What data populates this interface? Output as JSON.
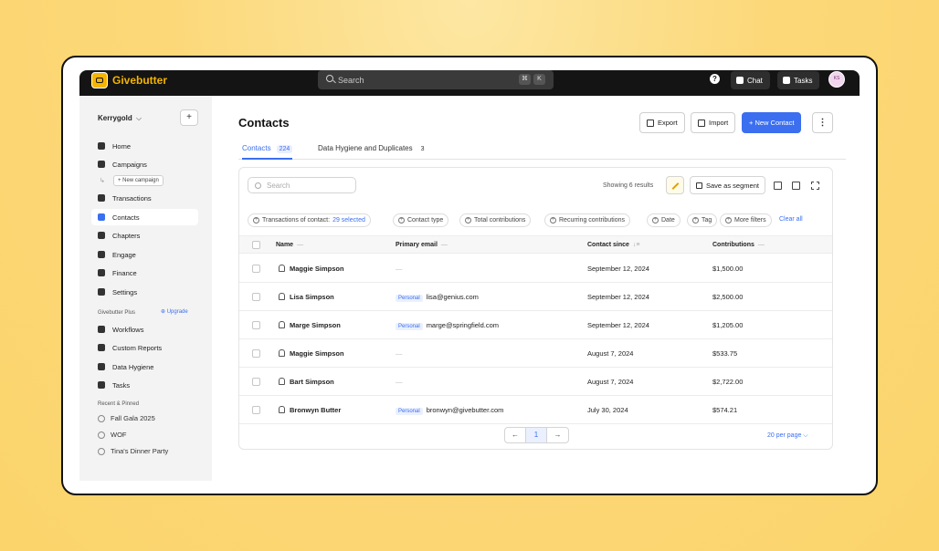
{
  "app": {
    "logo": "Givebutter"
  },
  "topbar": {
    "search_placeholder": "Search",
    "kbd_1": "⌘",
    "kbd_2": "K",
    "help": "?",
    "chat": "Chat",
    "tasks": "Tasks",
    "avatar_initials": "KS"
  },
  "sidebar": {
    "org": "Kerrygold",
    "org_caret": "⌵",
    "org_add": "+",
    "items": [
      {
        "label": "Home",
        "icon": "home-icon"
      },
      {
        "label": "Campaigns",
        "icon": "megaphone-icon"
      },
      {
        "label": "Transactions",
        "icon": "receipt-icon"
      },
      {
        "label": "Contacts",
        "icon": "users-icon"
      },
      {
        "label": "Chapters",
        "icon": "network-icon"
      },
      {
        "label": "Engage",
        "icon": "mail-icon"
      },
      {
        "label": "Finance",
        "icon": "bank-icon"
      },
      {
        "label": "Settings",
        "icon": "gear-icon"
      }
    ],
    "new_campaign": "+ New campaign",
    "plus_section": "Givebutter Plus",
    "upgrade": "⊕ Upgrade",
    "plus_items": [
      {
        "label": "Workflows",
        "icon": "workflow-icon"
      },
      {
        "label": "Custom Reports",
        "icon": "chart-icon"
      },
      {
        "label": "Data Hygiene",
        "icon": "hygiene-icon"
      },
      {
        "label": "Tasks",
        "icon": "tasks-icon"
      }
    ],
    "recent_section": "Recent & Pinned",
    "recent": [
      "Fall Gala 2025",
      "WOF",
      "Tina's Dinner Party"
    ]
  },
  "main": {
    "title": "Contacts",
    "export": "Export",
    "import": "Import",
    "new_contact": "+ New Contact",
    "more": "⋮",
    "tabs": [
      {
        "label": "Contacts",
        "count": "224"
      },
      {
        "label": "Data Hygiene and Duplicates",
        "count": "3"
      }
    ],
    "search_placeholder": "Search",
    "showing": "Showing 6 results",
    "save_segment": "Save as segment",
    "filters": [
      {
        "label": "Transactions of contact:",
        "value": "29 selected"
      },
      {
        "label": "Contact type"
      },
      {
        "label": "Total contributions"
      },
      {
        "label": "Recurring contributions"
      },
      {
        "label": "Date"
      },
      {
        "label": "Tag"
      },
      {
        "label": "More filters"
      }
    ],
    "clear_all": "Clear all",
    "columns": [
      "Name",
      "Primary email",
      "Contact since",
      "Contributions"
    ],
    "col_dash": "—",
    "sort_icon": "↓≡",
    "rows": [
      {
        "name": "Maggie Simpson",
        "tag": "",
        "email": "—",
        "since": "September 12, 2024",
        "contrib": "$1,500.00"
      },
      {
        "name": "Lisa Simpson",
        "tag": "Personal",
        "email": "lisa@genius.com",
        "since": "September 12, 2024",
        "contrib": "$2,500.00"
      },
      {
        "name": "Marge Simpson",
        "tag": "Personal",
        "email": "marge@springfield.com",
        "since": "September 12, 2024",
        "contrib": "$1,205.00"
      },
      {
        "name": "Maggie Simpson",
        "tag": "",
        "email": "—",
        "since": "August 7, 2024",
        "contrib": "$533.75"
      },
      {
        "name": "Bart Simpson",
        "tag": "",
        "email": "—",
        "since": "August 7, 2024",
        "contrib": "$2,722.00"
      },
      {
        "name": "Bronwyn Butter",
        "tag": "Personal",
        "email": "bronwyn@givebutter.com",
        "since": "July 30, 2024",
        "contrib": "$574.21"
      }
    ],
    "pager": {
      "prev": "←",
      "page": "1",
      "next": "→"
    },
    "per_page": "20 per page ⌵"
  },
  "colors": {
    "accent": "#3b6ff0",
    "brand": "#f5b400",
    "topbar": "#141414",
    "background": "#fcd879"
  }
}
